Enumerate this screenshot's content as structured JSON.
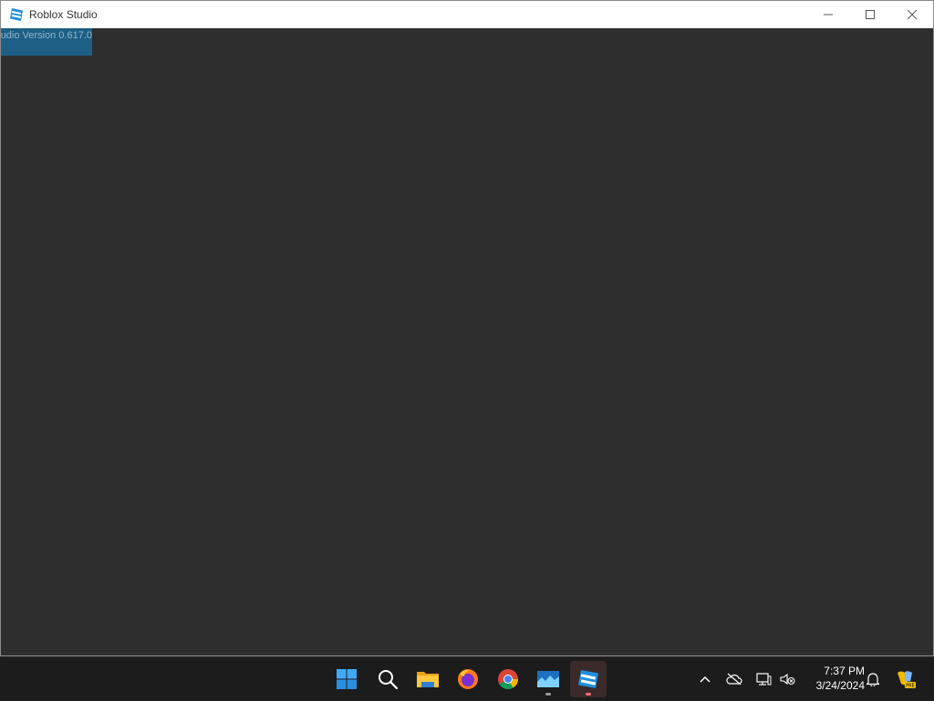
{
  "window": {
    "title": "Roblox Studio",
    "icon": "roblox-studio-icon",
    "controls": [
      "minimize-icon",
      "maximize-icon",
      "close-icon"
    ]
  },
  "content": {
    "version_text": "udio Version 0.617.0"
  },
  "taskbar": {
    "apps": [
      {
        "name": "start-icon"
      },
      {
        "name": "search-icon"
      },
      {
        "name": "file-explorer-icon"
      },
      {
        "name": "firefox-icon"
      },
      {
        "name": "chrome-icon"
      },
      {
        "name": "app-window-icon"
      },
      {
        "name": "roblox-studio-icon"
      }
    ],
    "tray": {
      "icons": [
        "chevron-up-icon",
        "cloud-offline-icon",
        "network-icon",
        "volume-muted-icon",
        "notification-bell-icon",
        "copilot-icon"
      ],
      "time": "7:37 PM",
      "date": "3/24/2024"
    }
  },
  "colors": {
    "content_bg": "#2e2e2e",
    "titlebar_bg": "#ffffff",
    "taskbar_bg": "#1c1c1c",
    "version_bg": "#1e5f86"
  }
}
